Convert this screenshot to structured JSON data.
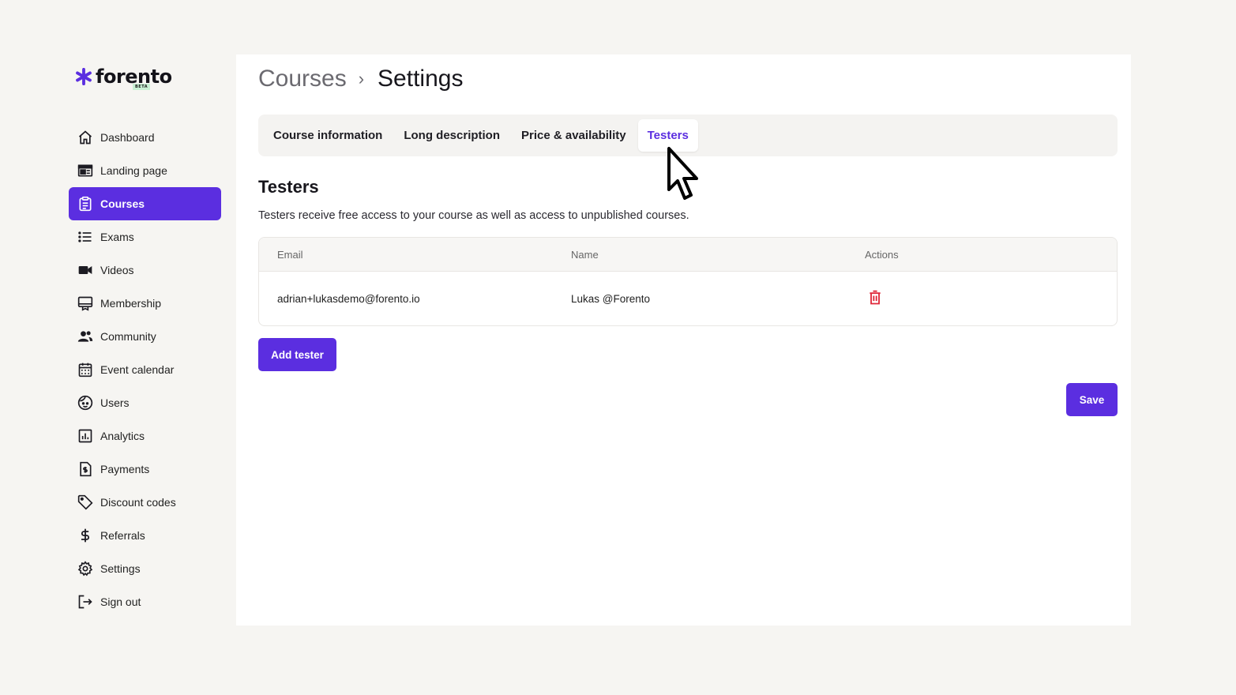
{
  "brand": {
    "name": "forento",
    "badge": "BETA",
    "accent": "#5b2ee0"
  },
  "sidebar": {
    "items": [
      {
        "label": "Dashboard",
        "icon": "home-icon"
      },
      {
        "label": "Landing page",
        "icon": "layout-icon"
      },
      {
        "label": "Courses",
        "icon": "clipboard-icon",
        "active": true
      },
      {
        "label": "Exams",
        "icon": "list-icon"
      },
      {
        "label": "Videos",
        "icon": "video-icon"
      },
      {
        "label": "Membership",
        "icon": "membership-icon"
      },
      {
        "label": "Community",
        "icon": "people-icon"
      },
      {
        "label": "Event calendar",
        "icon": "calendar-icon"
      },
      {
        "label": "Users",
        "icon": "face-icon"
      },
      {
        "label": "Analytics",
        "icon": "chart-icon"
      },
      {
        "label": "Payments",
        "icon": "invoice-icon"
      },
      {
        "label": "Discount codes",
        "icon": "tag-icon"
      },
      {
        "label": "Referrals",
        "icon": "dollar-icon"
      },
      {
        "label": "Settings",
        "icon": "gear-icon"
      },
      {
        "label": "Sign out",
        "icon": "sign-out-icon"
      }
    ]
  },
  "header": {
    "breadcrumb_parent": "Courses",
    "breadcrumb_separator": "›",
    "title": "Settings"
  },
  "tabs": [
    {
      "label": "Course information"
    },
    {
      "label": "Long description"
    },
    {
      "label": "Price & availability"
    },
    {
      "label": "Testers",
      "active": true
    }
  ],
  "testers": {
    "title": "Testers",
    "description": "Testers receive free access to your course as well as access to unpublished courses.",
    "columns": [
      "Email",
      "Name",
      "Actions"
    ],
    "rows": [
      {
        "email": "adrian+lukasdemo@forento.io",
        "name": "Lukas @Forento",
        "action_icon": "trash-icon"
      }
    ],
    "add_label": "Add tester"
  },
  "save_label": "Save",
  "colors": {
    "danger": "#e0283a",
    "background": "#f6f5f2"
  }
}
